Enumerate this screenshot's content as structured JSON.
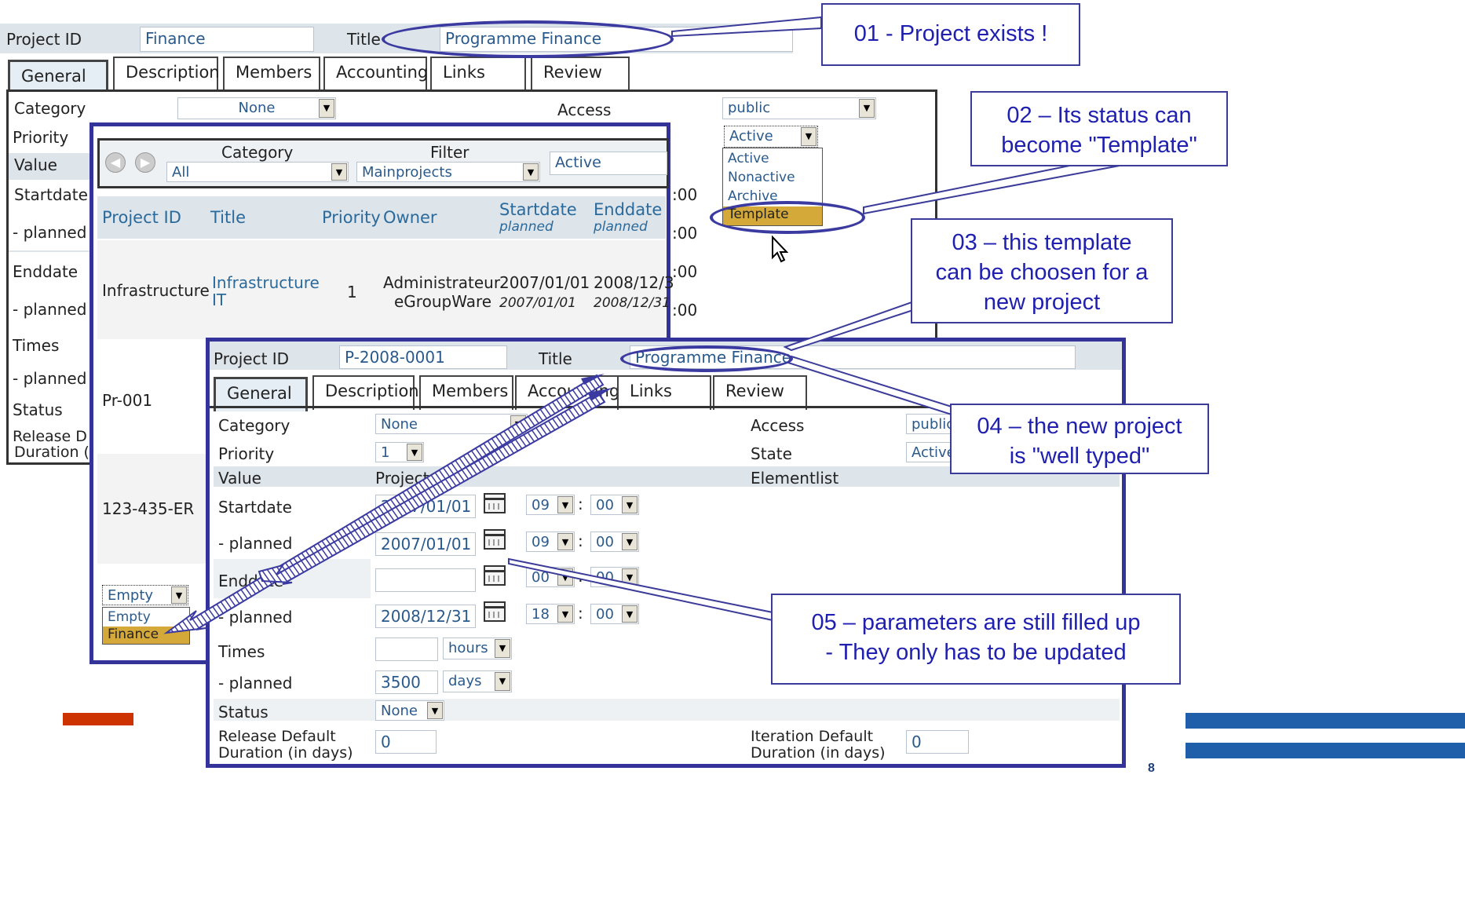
{
  "top_form": {
    "project_id_label": "Project ID",
    "project_id_value": "Finance",
    "title_label": "Title",
    "title_value": "Programme Finance",
    "tabs": [
      "General",
      "Description",
      "Members",
      "Accounting",
      "Links",
      "Review"
    ],
    "category_label": "Category",
    "category_value": "None",
    "access_label": "Access",
    "access_value": "public",
    "priority_label": "Priority",
    "value_label": "Value",
    "startdate_label": "Startdate",
    "planned_label": "- planned",
    "enddate_label": "Enddate",
    "times_label": "Times",
    "status_label": "Status",
    "release_label": "Release D",
    "duration_label": "Duration (",
    "status_select_value": "Active",
    "status_options": [
      "Active",
      "Nonactive",
      "Archive",
      "Template"
    ],
    "time_fragments": [
      ":00",
      ":00",
      ":00",
      ":00"
    ]
  },
  "list_window": {
    "category_label": "Category",
    "filter_label": "Filter",
    "category_value": "All",
    "filter_value": "Mainprojects",
    "status_value": "Active",
    "headers": {
      "project_id": "Project ID",
      "title": "Title",
      "priority": "Priority",
      "owner": "Owner",
      "startdate": "Startdate",
      "startdate_sub": "planned",
      "enddate": "Enddate",
      "enddate_sub": "planned"
    },
    "rows": [
      {
        "id": "Infrastructure",
        "title_1": "Infrastructure",
        "title_2": "IT",
        "priority": "1",
        "owner_1": "Administrateur",
        "owner_2": "eGroupWare",
        "start": "2007/01/01",
        "start_planned": "2007/01/01",
        "end": "2008/12/3",
        "end_planned": "2008/12/31"
      },
      {
        "id": "Pr-001"
      },
      {
        "id": "123-435-ER"
      }
    ],
    "template_select_value": "Empty",
    "template_options": [
      "Empty",
      "Finance"
    ]
  },
  "new_form": {
    "project_id_label": "Project ID",
    "project_id_value": "P-2008-0001",
    "title_label": "Title",
    "title_value": "Programme Finance",
    "tabs": [
      "General",
      "Description",
      "Members",
      "Accounting",
      "Links",
      "Review"
    ],
    "category_label": "Category",
    "category_value": "None",
    "access_label": "Access",
    "access_value": "public",
    "priority_label": "Priority",
    "priority_value": "1",
    "state_label": "State",
    "state_value": "Active",
    "value_label": "Value",
    "value_value": "Project",
    "elementlist_label": "Elementlist",
    "startdate_label": "Startdate",
    "startdate_value": "2007/01/01",
    "startdate_hour": "09",
    "startdate_min": "00",
    "planned_label": "- planned",
    "planned_start_value": "2007/01/01",
    "planned_start_hour": "09",
    "planned_start_min": "00",
    "enddate_label": "Enddate",
    "enddate_hour": "00",
    "enddate_min": "00",
    "planned_end_value": "2008/12/31",
    "planned_end_hour": "18",
    "planned_end_min": "00",
    "times_label": "Times",
    "times_unit": "hours",
    "planned_times_value": "3500",
    "planned_times_unit": "days",
    "status_label": "Status",
    "status_value": "None",
    "release_label_1": "Release Default",
    "release_label_2": "Duration (in days)",
    "release_value": "0",
    "iteration_label_1": "Iteration Default",
    "iteration_label_2": "Duration (in days)",
    "iteration_value": "0"
  },
  "callouts": {
    "c1": "01 - Project exists !",
    "c2_1": "02 – Its status can",
    "c2_2": "become \"Template\"",
    "c3_1": "03 – this template",
    "c3_2": "can be choosen for a",
    "c3_3": "new project",
    "c4_1": "04 – the new project",
    "c4_2": "is \"well typed\"",
    "c5_1": "05 – parameters are still filled up",
    "c5_2": "- They only has to be updated"
  },
  "page_number": "8",
  "colors": {
    "callout_border": "#3b3b9a",
    "callout_text": "#2020b0",
    "frame": "#33339a",
    "band": "#dde4ea",
    "accent_red": "#cc3300",
    "accent_blue": "#1f5faa",
    "template_highlight": "#d4a93a"
  }
}
